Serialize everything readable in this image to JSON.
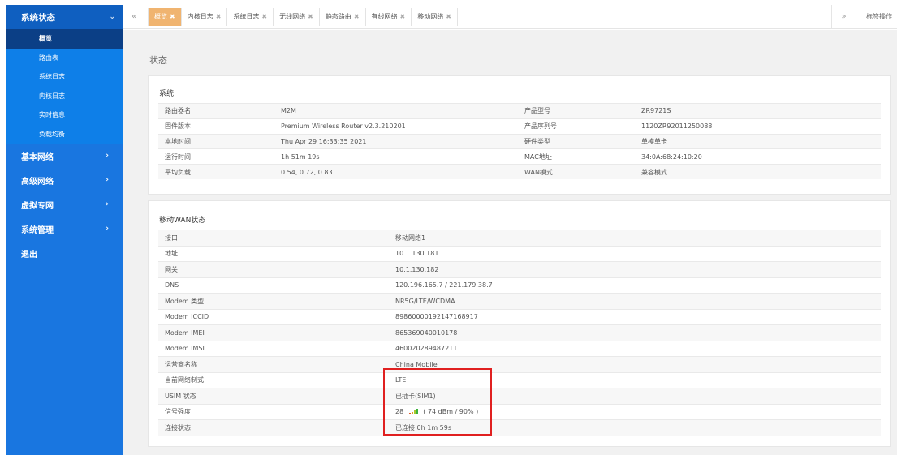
{
  "sidebar": {
    "header": "系统状态",
    "submenu": [
      "概览",
      "路由表",
      "系统日志",
      "内核日志",
      "实时信息",
      "负载均衡"
    ],
    "main": [
      "基本网络",
      "高级网络",
      "虚拟专网",
      "系统管理",
      "退出"
    ]
  },
  "tabs": [
    {
      "label": "概览"
    },
    {
      "label": "内核日志"
    },
    {
      "label": "系统日志"
    },
    {
      "label": "无线网络"
    },
    {
      "label": "静态路由"
    },
    {
      "label": "有线网络"
    },
    {
      "label": "移动网络"
    }
  ],
  "tabbar": {
    "ops_label": "标签操作"
  },
  "page": {
    "title": "状态"
  },
  "system": {
    "title": "系统",
    "rows": [
      [
        "路由器名",
        "M2M",
        "产品型号",
        "ZR9721S"
      ],
      [
        "固件版本",
        "Premium Wireless Router v2.3.210201",
        "产品序列号",
        "1120ZR92011250088"
      ],
      [
        "本地时间",
        "Thu Apr 29 16:33:35 2021",
        "硬件类型",
        "单模单卡"
      ],
      [
        "运行时间",
        "1h 51m 19s",
        "MAC地址",
        "34:0A:68:24:10:20"
      ],
      [
        "平均负载",
        "0.54, 0.72, 0.83",
        "WAN模式",
        "兼容模式"
      ]
    ]
  },
  "wan": {
    "title": "移动WAN状态",
    "rows": [
      [
        "接口",
        "移动网络1"
      ],
      [
        "地址",
        "10.1.130.181"
      ],
      [
        "网关",
        "10.1.130.182"
      ],
      [
        "DNS",
        "120.196.165.7 / 221.179.38.7"
      ],
      [
        "Modem 类型",
        "NR5G/LTE/WCDMA"
      ],
      [
        "Modem ICCID",
        "89860000192147168917"
      ],
      [
        "Modem IMEI",
        "865369040010178"
      ],
      [
        "Modem IMSI",
        "460020289487211"
      ],
      [
        "运营商名称",
        "China Mobile"
      ],
      [
        "当前网络制式",
        "LTE"
      ],
      [
        "USIM 状态",
        "已插卡(SIM1)"
      ],
      [
        "信号强度",
        ""
      ],
      [
        "连接状态",
        "已连接 0h 1m 59s"
      ]
    ],
    "signal": {
      "value": "28",
      "detail": "( 74 dBm / 90% )"
    }
  },
  "colors": {
    "sidebar": "#1976e0",
    "active_tab": "#f0b470",
    "highlight": "#e02020"
  }
}
